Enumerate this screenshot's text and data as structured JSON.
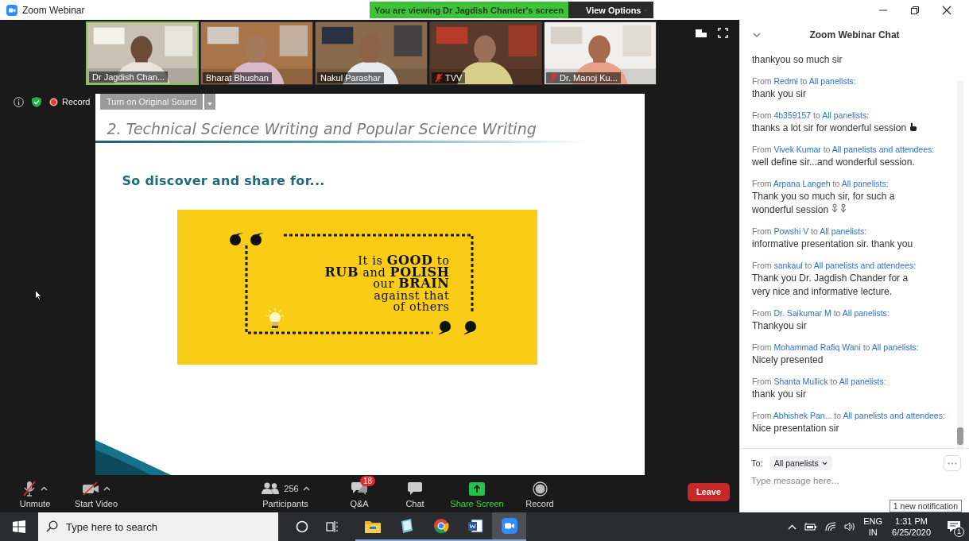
{
  "window": {
    "title": "Zoom Webinar"
  },
  "share_banner": {
    "text": "You are viewing Dr Jagdish Chander's screen",
    "view_options": "View Options"
  },
  "videos": [
    {
      "name": "Dr Jagdish Chan...",
      "muted": false,
      "selected": true
    },
    {
      "name": "Bharat Bhushan",
      "muted": false,
      "selected": false
    },
    {
      "name": "Nakul Parashar",
      "muted": false,
      "selected": false
    },
    {
      "name": "TVV",
      "muted": true,
      "selected": false
    },
    {
      "name": "Dr. Manoj Ku...",
      "muted": true,
      "selected": false
    }
  ],
  "meeting_bar": {
    "record_label": "Record",
    "original_sound_button": "Turn on Original Sound"
  },
  "slide": {
    "title": "2. Technical Science Writing and Popular Science Writing",
    "subtitle": "So discover and share for...",
    "quote_lines": [
      "It is **GOOD** to",
      "**RUB** and **POLISH**",
      "our **BRAIN**",
      "against that",
      "of others"
    ]
  },
  "toolbar": [
    {
      "kind": "mic",
      "label": "Unmute",
      "caret": true
    },
    {
      "kind": "video",
      "label": "Start Video",
      "caret": true
    },
    {
      "kind": "participants",
      "label": "Participants",
      "count": "256",
      "caret": true
    },
    {
      "kind": "qa",
      "label": "Q&A",
      "badge": "18",
      "caret": false
    },
    {
      "kind": "chat",
      "label": "Chat",
      "caret": false
    },
    {
      "kind": "share",
      "label": "Share Screen",
      "caret": false
    },
    {
      "kind": "record",
      "label": "Record",
      "caret": false
    }
  ],
  "leave_button": "Leave",
  "chat": {
    "title": "Zoom Webinar Chat",
    "messages": [
      {
        "kind": "text",
        "text": "thankyou so much sir"
      },
      {
        "from": "From",
        "sender": "Redmi",
        "to": "to",
        "recipient": "All panelists:",
        "text": "thank you sir",
        "kind": "text"
      },
      {
        "from": "From",
        "sender": "4b359157",
        "to": "to",
        "recipient": "All panelists:",
        "text": "thanks a lot sir for wonderful session",
        "kind": "hand-emoji"
      },
      {
        "from": "From",
        "sender": "Vivek Kumar",
        "to": "to",
        "recipient": "All panelists and attendees:",
        "text": "well define sir...and wonderful session.",
        "kind": "text"
      },
      {
        "from": "From",
        "sender": "Arpana Langeh",
        "to": "to",
        "recipient": "All panelists:",
        "text": "Thank you so much sir, for such a wonderful session",
        "kind": "flowers-emoji"
      },
      {
        "from": "From",
        "sender": "Powshi V",
        "to": "to",
        "recipient": "All panelists:",
        "text": "informative presentation sir. thank you",
        "kind": "text"
      },
      {
        "from": "From",
        "sender": "sankaul",
        "to": "to",
        "recipient": "All panelists and attendees:",
        "text": "Thank you Dr. Jagdish Chander for a very nice and informative lecture.",
        "kind": "text"
      },
      {
        "from": "From",
        "sender": "Dr. Saikumar M",
        "to": "to",
        "recipient": "All panelists:",
        "text": "Thankyou sir",
        "kind": "text"
      },
      {
        "from": "From",
        "sender": "Mohammad Rafiq Wani",
        "to": "to",
        "recipient": "All panelists:",
        "text": "Nicely presented",
        "kind": "text"
      },
      {
        "from": "From",
        "sender": "Shanta Mullick",
        "to": "to",
        "recipient": "All panelists:",
        "text": "thank you sir",
        "kind": "text"
      },
      {
        "from": "From",
        "sender": "Abhishek Pan...",
        "to": "to",
        "recipient": "All panelists and attendees:",
        "text": "Nice presentation sir",
        "kind": "text"
      }
    ],
    "to_label": "To:",
    "recipient": "All panelists",
    "placeholder": "Type message here...",
    "notification": "1 new notification"
  },
  "taskbar": {
    "search_placeholder": "Type here to search",
    "apps": [
      {
        "kind": "folder",
        "selected": false
      },
      {
        "kind": "notebook",
        "selected": false
      },
      {
        "kind": "browser",
        "selected": false
      },
      {
        "kind": "document",
        "selected": false
      },
      {
        "kind": "camera",
        "selected": true
      }
    ],
    "language": "ENG",
    "region": "IN",
    "time": "1:31 PM",
    "date": "6/25/2020",
    "notification_count": "1"
  }
}
